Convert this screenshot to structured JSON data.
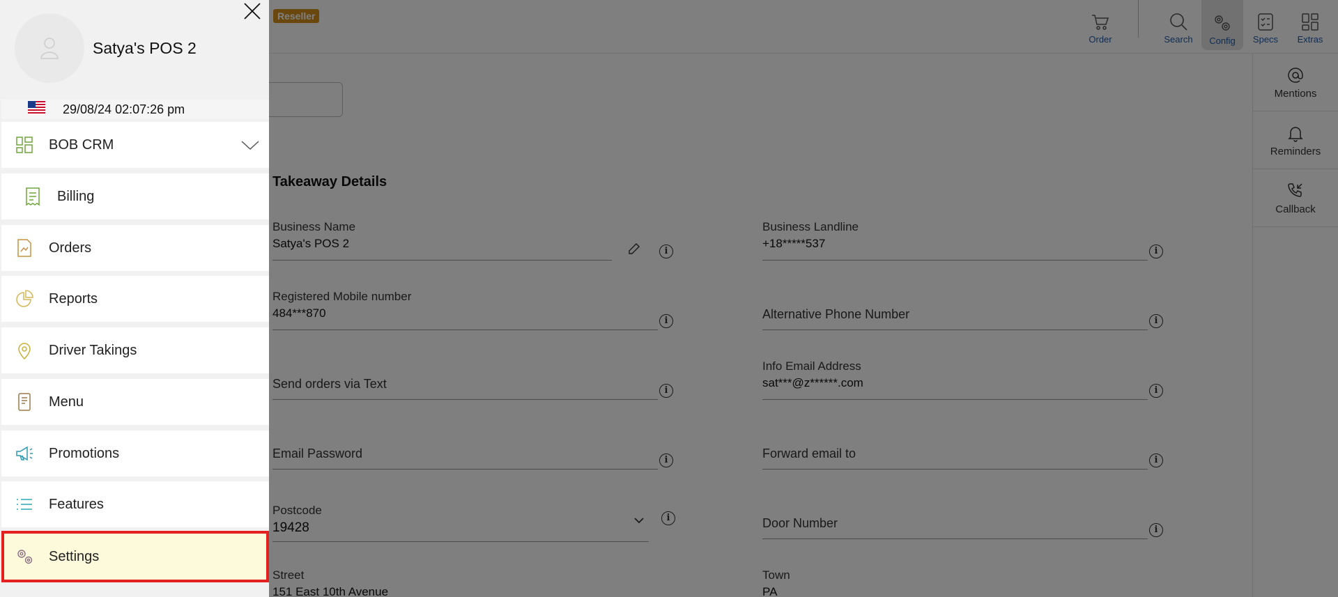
{
  "header": {
    "badge": "Reseller",
    "nav": [
      {
        "label": "Order",
        "icon": "cart-icon"
      },
      {
        "label": "Search",
        "icon": "search-icon"
      },
      {
        "label": "Config",
        "icon": "gears-icon",
        "active": true
      },
      {
        "label": "Specs",
        "icon": "checklist-icon"
      },
      {
        "label": "Extras",
        "icon": "grid-icon"
      }
    ]
  },
  "right_sidebar": {
    "items": [
      {
        "label": "Mentions",
        "icon": "at-icon"
      },
      {
        "label": "Reminders",
        "icon": "bell-icon"
      },
      {
        "label": "Callback",
        "icon": "phone-callback-icon"
      }
    ]
  },
  "form": {
    "section_title": "Takeaway Details",
    "business_name": {
      "label": "Business Name",
      "value": "Satya's POS 2"
    },
    "business_landline": {
      "label": "Business Landline",
      "value": "+18*****537"
    },
    "registered_mobile": {
      "label": "Registered Mobile number",
      "value": "484***870"
    },
    "alt_phone": {
      "label": "Alternative Phone Number"
    },
    "send_orders_text": {
      "label": "Send orders via Text"
    },
    "info_email": {
      "label": "Info Email Address",
      "value": "sat***@z******.com"
    },
    "email_password": {
      "label": "Email Password"
    },
    "forward_email": {
      "label": "Forward email to"
    },
    "postcode": {
      "label": "Postcode",
      "value": "19428"
    },
    "door_number": {
      "label": "Door Number"
    },
    "street": {
      "label": "Street",
      "value": "151 East 10th Avenue"
    },
    "town": {
      "label": "Town",
      "value": "PA"
    }
  },
  "drawer": {
    "store_name": "Satya's POS 2",
    "datetime": "29/08/24 02:07:26 pm",
    "menu": [
      {
        "label": "BOB CRM",
        "icon": "dashboard-icon"
      },
      {
        "label": "Billing",
        "icon": "receipt-icon"
      },
      {
        "label": "Orders",
        "icon": "orders-icon"
      },
      {
        "label": "Reports",
        "icon": "pie-chart-icon"
      },
      {
        "label": "Driver Takings",
        "icon": "location-pin-icon"
      },
      {
        "label": "Menu",
        "icon": "menu-card-icon"
      },
      {
        "label": "Promotions",
        "icon": "megaphone-icon"
      },
      {
        "label": "Features",
        "icon": "list-icon"
      },
      {
        "label": "Settings",
        "icon": "settings-gears-icon"
      }
    ]
  },
  "colors": {
    "accent_blue": "#1d5aa8",
    "badge_orange": "#d38f1a",
    "highlight_border": "#e42020",
    "highlight_fill": "#fdfadb"
  }
}
